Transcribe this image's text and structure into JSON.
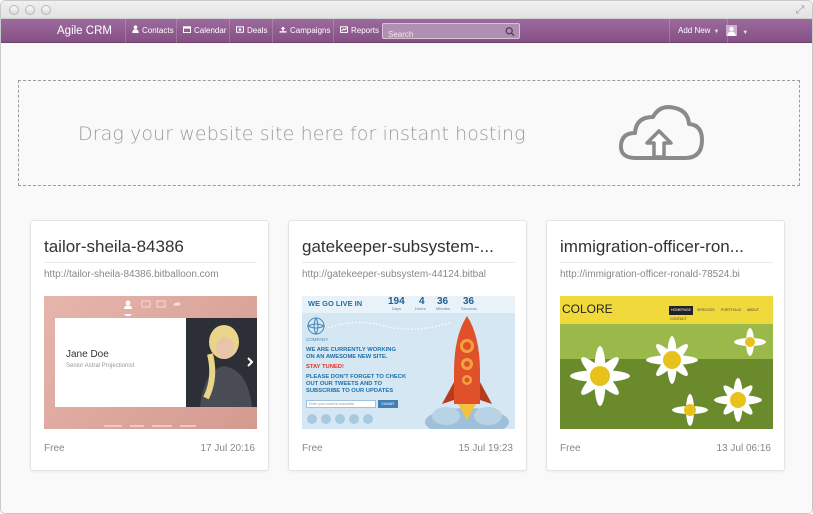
{
  "app": {
    "brand": "Agile CRM",
    "nav": [
      {
        "icon": "contacts-icon",
        "label": "Contacts"
      },
      {
        "icon": "calendar-icon",
        "label": "Calendar"
      },
      {
        "icon": "deals-icon",
        "label": "Deals"
      },
      {
        "icon": "campaigns-icon",
        "label": "Campaigns"
      },
      {
        "icon": "reports-icon",
        "label": "Reports"
      }
    ],
    "search_placeholder": "Search",
    "add_new": "Add New"
  },
  "dropzone": {
    "text": "Drag your website site here for instant hosting",
    "icon": "cloud-upload-icon"
  },
  "sites": [
    {
      "title": "tailor-sheila-84386",
      "url": "http://tailor-sheila-84386.bitballoon.com",
      "plan": "Free",
      "date": "17 Jul 20:16",
      "preview": {
        "name": "Jane Doe",
        "role": "Senior Astral Projectionist"
      }
    },
    {
      "title": "gatekeeper-subsystem-...",
      "url": "http://gatekeeper-subsystem-44124.bitbal",
      "plan": "Free",
      "date": "15 Jul 19:23",
      "preview": {
        "headline": "WE GO LIVE IN",
        "countdown": [
          {
            "value": "194",
            "unit": "Days"
          },
          {
            "value": "4",
            "unit": "Hours"
          },
          {
            "value": "36",
            "unit": "Minutes"
          },
          {
            "value": "36",
            "unit": "Seconds"
          }
        ],
        "brand": "COMPANY",
        "line1": "WE ARE CURRENTLY WORKING",
        "line2": "ON AN AWESOME NEW SITE.",
        "line3": "STAY TUNED!",
        "line4": "PLEASE DON'T FORGET TO CHECK",
        "line5": "OUT OUR TWEETS AND TO",
        "line6": "SUBSCRIBE TO OUR UPDATES",
        "email_placeholder": "Enter your email to subscribe",
        "submit": "SUBMIT"
      }
    },
    {
      "title": "immigration-officer-ron...",
      "url": "http://immigration-officer-ronald-78524.bi",
      "plan": "Free",
      "date": "13 Jul 06:16",
      "preview": {
        "brand": "COLORE",
        "menu": [
          "HOMEPAGE",
          "SERVICES",
          "PORTFOLIO",
          "ABOUT",
          "CONTACT"
        ]
      }
    }
  ]
}
